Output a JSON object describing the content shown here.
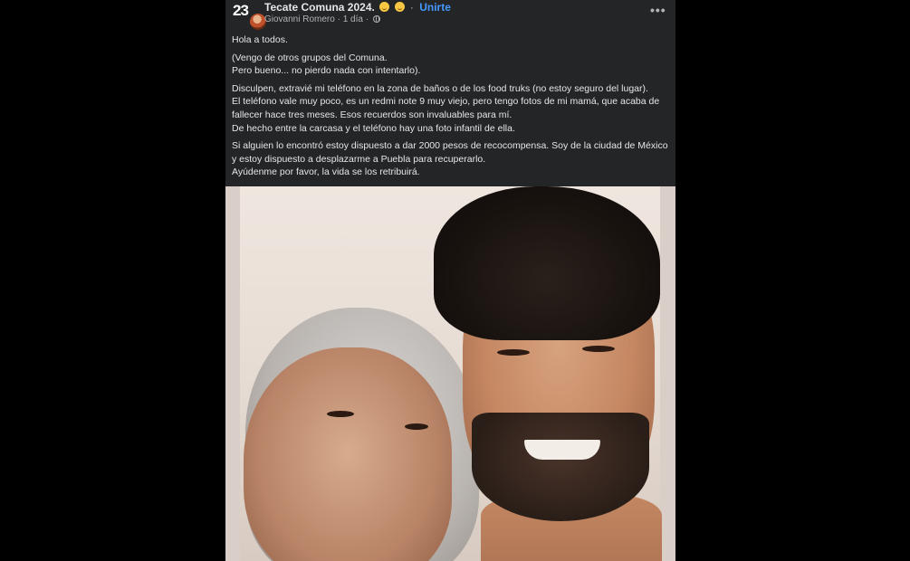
{
  "post": {
    "group_avatar_text": "23",
    "group_name": "Tecate Comuna 2024.",
    "join_label": "Unirte",
    "author": "Giovanni Romero",
    "time": "1 día",
    "dot": "·",
    "more_icon": "more-horizontal-icon",
    "paragraphs": [
      "Hola a todos.",
      "(Vengo de otros grupos del Comuna.\nPero bueno... no pierdo nada con intentarlo).",
      "Disculpen, extravié mi teléfono en la zona de baños o de los food truks (no estoy seguro del lugar).\nEl teléfono vale muy poco, es un redmi note 9 muy viejo, pero tengo fotos de mi mamá, que acaba de fallecer hace tres meses. Esos recuerdos son invaluables para mí.\nDe hecho entre la carcasa y el teléfono hay una foto infantil de ella.",
      "Si alguien lo encontró estoy dispuesto a dar 2000 pesos de recocompensa. Soy de la ciudad de México y estoy dispuesto a desplazarme a Puebla para recuperarlo.\nAyúdenme por favor, la vida se los retribuirá."
    ]
  },
  "colors": {
    "background": "#000000",
    "card": "#242526",
    "text": "#e4e6eb",
    "secondary_text": "#b0b3b8",
    "link": "#4599ff"
  }
}
